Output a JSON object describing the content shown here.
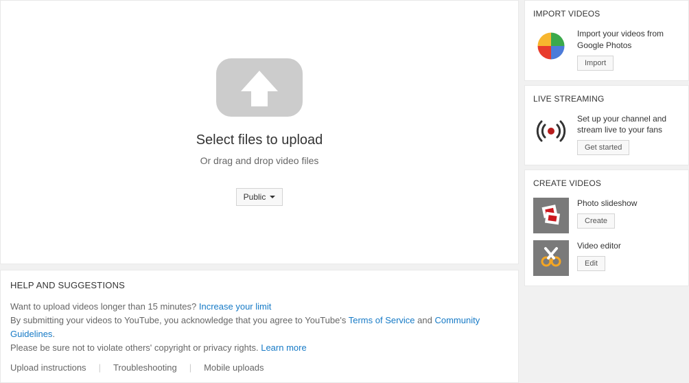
{
  "upload": {
    "title": "Select files to upload",
    "sub": "Or drag and drop video files",
    "privacy_label": "Public"
  },
  "help": {
    "title": "HELP AND SUGGESTIONS",
    "line1_pre": "Want to upload videos longer than 15 minutes? ",
    "line1_link": "Increase your limit",
    "line2_pre": "By submitting your videos to YouTube, you acknowledge that you agree to YouTube's ",
    "line2_tos": "Terms of Service",
    "line2_and": " and ",
    "line2_cg": "Community Guidelines",
    "line2_end": ".",
    "line3_pre": "Please be sure not to violate others' copyright or privacy rights. ",
    "line3_link": "Learn more",
    "bottom": {
      "instructions": "Upload instructions",
      "troubleshooting": "Troubleshooting",
      "mobile": "Mobile uploads"
    }
  },
  "side": {
    "import": {
      "title": "IMPORT VIDEOS",
      "text": "Import your videos from Google Photos",
      "button": "Import"
    },
    "live": {
      "title": "LIVE STREAMING",
      "text": "Set up your channel and stream live to your fans",
      "button": "Get started"
    },
    "create": {
      "title": "CREATE VIDEOS",
      "slideshow": {
        "title": "Photo slideshow",
        "button": "Create"
      },
      "editor": {
        "title": "Video editor",
        "button": "Edit"
      }
    }
  }
}
